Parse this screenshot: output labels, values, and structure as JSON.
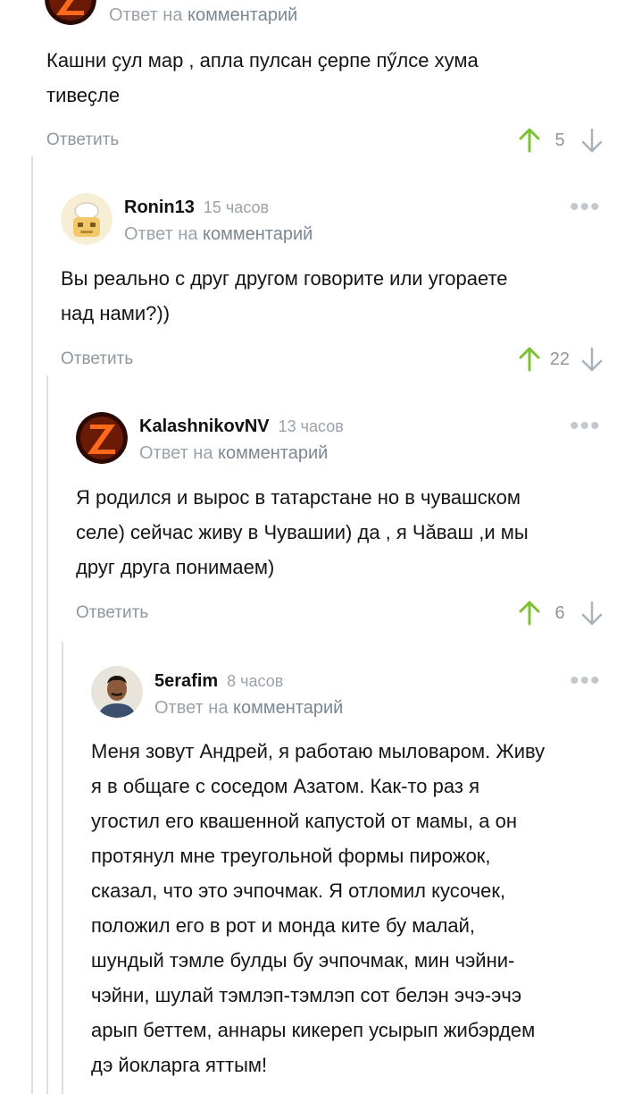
{
  "comments": [
    {
      "reply_prefix": "Ответ на",
      "reply_link": "комментарий",
      "text_lines": [
        "Кашни ҫул мар , апла пулсан ҫерпе пӳлсе хума",
        "тивеҫле"
      ],
      "reply_label": "Ответить",
      "votes": "5"
    },
    {
      "username": "Ronin13",
      "time": "15 часов",
      "reply_prefix": "Ответ на",
      "reply_link": "комментарий",
      "text_lines": [
        "Вы реально с друг другом говорите или угораете",
        "над нами?))"
      ],
      "reply_label": "Ответить",
      "votes": "22"
    },
    {
      "username": "KalashnikovNV",
      "time": "13 часов",
      "reply_prefix": "Ответ на",
      "reply_link": "комментарий",
      "text_lines": [
        "Я родился и вырос в татарстане но в чувашском",
        "селе) сейчас живу в Чувашии) да , я Чӑваш ,и мы",
        "друг друга понимаем)"
      ],
      "reply_label": "Ответить",
      "votes": "6"
    },
    {
      "username": "5erafim",
      "time": "8 часов",
      "reply_prefix": "Ответ на",
      "reply_link": "комментарий",
      "text_lines": [
        "Меня зовут Андрей, я работаю мыловаром. Живу",
        "я в общаге с соседом Азатом. Как-то раз я",
        "угостил его квашенной капустой от мамы, а он",
        "протянул мне треугольной формы пирожок,",
        "сказал, что это эчпочмак. Я отломил кусочек,",
        "положил его в рот и монда ките бу малай,",
        "шундый тэмле булды бу эчпочмак, мин чэйни-",
        "чэйни, шулай тэмлэп-тэмлэп сот белэн эчэ-эчэ",
        "арып беттем, аннары кикереп усырып жибэрдем",
        "дэ йокларга яттым!"
      ]
    }
  ],
  "colors": {
    "upvote": "#7cc230",
    "downvote": "#a9b2b9",
    "muted": "#9ba3aa"
  },
  "icons": [
    "z-logo-avatar-icon",
    "cartoon-avatar-icon",
    "photo-avatar-icon",
    "more-dots-icon",
    "arrow-up-icon",
    "arrow-down-icon"
  ]
}
